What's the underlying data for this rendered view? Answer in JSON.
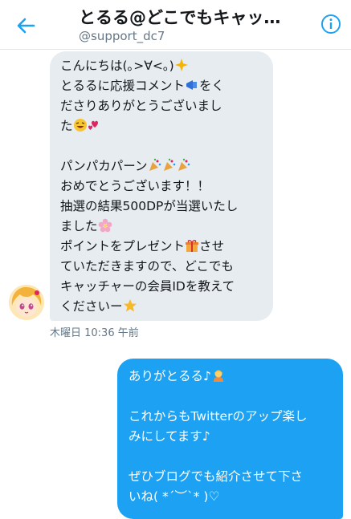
{
  "header": {
    "title": "とるる@どこでもキャッチャー",
    "handle": "@support_dc7",
    "back_icon": "back-arrow-icon",
    "info_icon": "info-icon"
  },
  "conversation": {
    "incoming": {
      "lines": [
        "こんにちは(｡>∀<｡)",
        "とるるに応援コメント",
        "をく",
        "ださりありがとうございまし",
        "た",
        "",
        "パンパカパーン",
        "おめでとうございます！！",
        "抽選の結果500DPが当選いたし",
        "ました",
        "ポイントをプレゼント",
        "させ",
        "ていただきますので、どこでも",
        "キャッチャーの会員IDを教えて",
        "くださいー"
      ],
      "timestamp": "木曜日 10:36 午前"
    },
    "outgoing": {
      "line1": "ありがとるる♪",
      "line2": "これからもTwitterのアップ楽し",
      "line3": "みにしてます♪",
      "line4": "ぜひブログでも紹介させて下さ",
      "line5": "いね( *´︶`* )♡"
    }
  },
  "colors": {
    "accent": "#1da1f2",
    "incoming_bubble": "#e6ecf0",
    "secondary_text": "#657786"
  }
}
